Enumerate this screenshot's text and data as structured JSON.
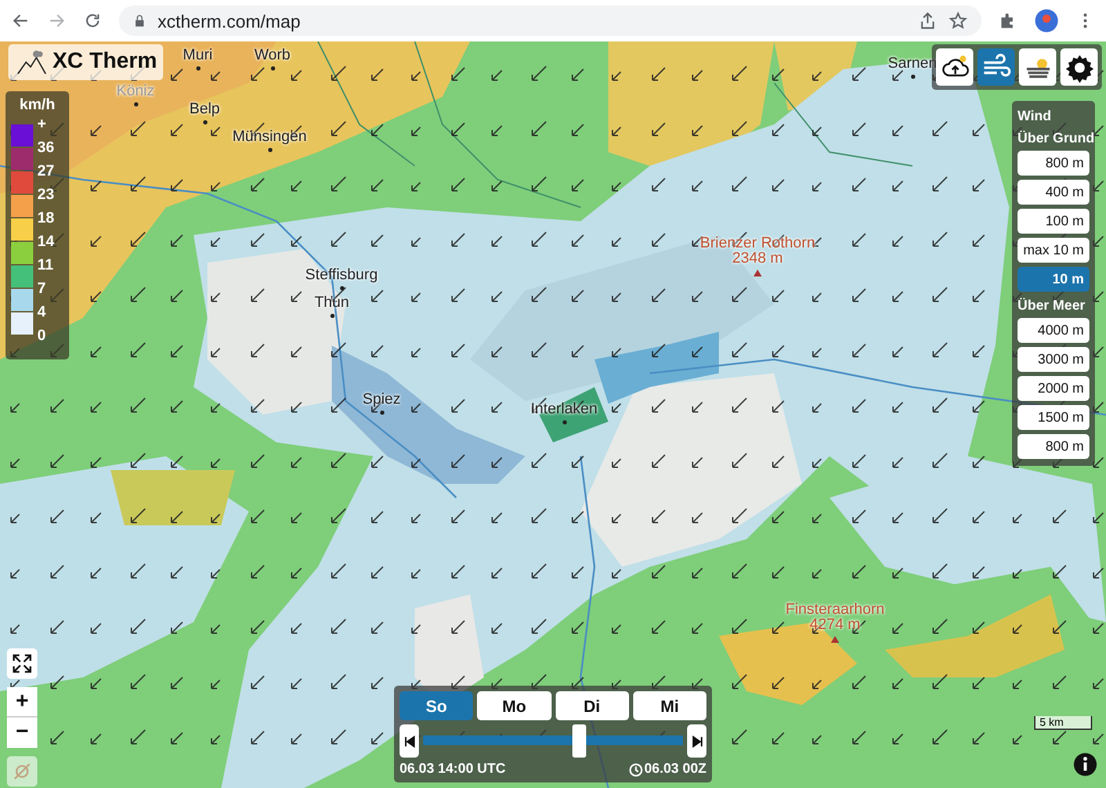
{
  "browser": {
    "url": "xctherm.com/map"
  },
  "logo": {
    "text": "XC Therm"
  },
  "legend": {
    "unit": "km/h",
    "labels": [
      "+",
      "36",
      "27",
      "23",
      "18",
      "14",
      "11",
      "7",
      "4",
      "0"
    ],
    "swatches": [
      {
        "color": "#6a0fd6"
      },
      {
        "color": "#9c2c6c"
      },
      {
        "color": "#e04a3c"
      },
      {
        "color": "#f4a04a"
      },
      {
        "color": "#f7cf48"
      },
      {
        "color": "#8ccf3e"
      },
      {
        "color": "#45c07a"
      },
      {
        "color": "#a8d8ec"
      },
      {
        "color": "#e6f1fb"
      }
    ]
  },
  "layers": [
    {
      "kind": "cloud",
      "selected": false
    },
    {
      "kind": "wind",
      "selected": true
    },
    {
      "kind": "sun-layers",
      "selected": false
    },
    {
      "kind": "settings",
      "selected": false
    }
  ],
  "wind_panel": {
    "title": "Wind",
    "groups": [
      {
        "heading": "Über Grund",
        "options": [
          {
            "label": "800 m",
            "selected": false
          },
          {
            "label": "400 m",
            "selected": false
          },
          {
            "label": "100 m",
            "selected": false
          },
          {
            "label": "max 10 m",
            "selected": false
          },
          {
            "label": "10 m",
            "selected": true
          }
        ]
      },
      {
        "heading": "Über Meer",
        "options": [
          {
            "label": "4000 m",
            "selected": false
          },
          {
            "label": "3000 m",
            "selected": false
          },
          {
            "label": "2000 m",
            "selected": false
          },
          {
            "label": "1500 m",
            "selected": false
          },
          {
            "label": "800 m",
            "selected": false
          }
        ]
      }
    ]
  },
  "places": [
    {
      "kind": "town",
      "name": "Muri"
    },
    {
      "kind": "town",
      "name": "Worb"
    },
    {
      "kind": "town",
      "name": "Köniz"
    },
    {
      "kind": "town",
      "name": "Belp"
    },
    {
      "kind": "town",
      "name": "Münsingen"
    },
    {
      "kind": "town",
      "name": "Sarnen"
    },
    {
      "kind": "town",
      "name": "Steffisburg"
    },
    {
      "kind": "town",
      "name": "Thun"
    },
    {
      "kind": "town",
      "name": "Spiez"
    },
    {
      "kind": "town",
      "name": "Interlaken"
    },
    {
      "kind": "peak",
      "name": "Brienzer Rothorn",
      "elevation": "2348 m"
    },
    {
      "kind": "peak",
      "name": "Finsteraarhorn",
      "elevation": "4274 m"
    }
  ],
  "timeline": {
    "days": [
      {
        "label": "So",
        "selected": true
      },
      {
        "label": "Mo",
        "selected": false
      },
      {
        "label": "Di",
        "selected": false
      },
      {
        "label": "Mi",
        "selected": false
      }
    ],
    "level": 0.6,
    "time": "06.03 14:00 UTC",
    "run": "06.03 00Z"
  },
  "zoom": {
    "in": "+",
    "out": "−"
  },
  "scale": "5 km"
}
